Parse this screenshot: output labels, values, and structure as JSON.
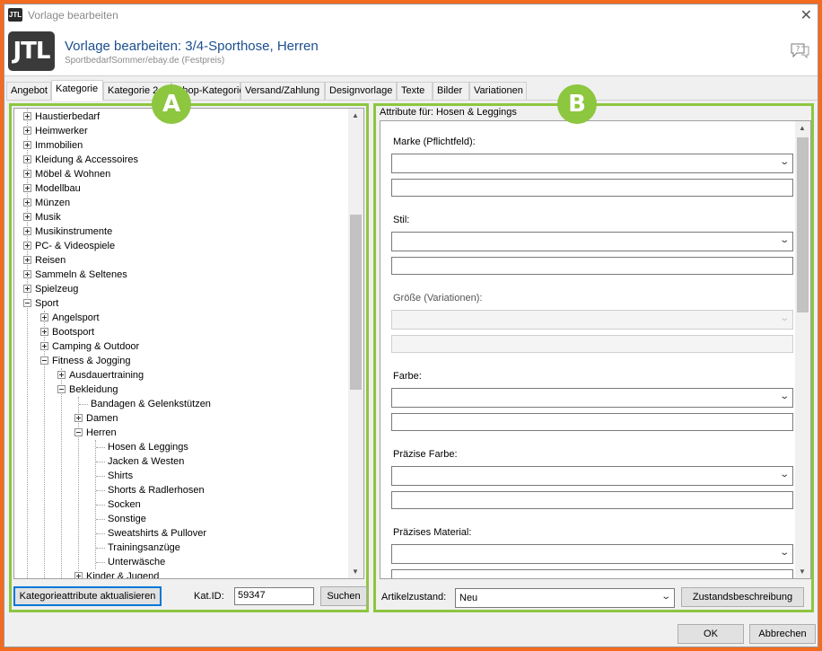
{
  "window": {
    "title": "Vorlage bearbeiten",
    "close": "✕"
  },
  "header": {
    "logo_text": "JTL",
    "title": "Vorlage bearbeiten: 3/4-Sporthose, Herren",
    "subtitle": "SportbedarfSommer/ebay.de (Festpreis)",
    "help_icon": "speech-bubble-help-icon"
  },
  "tabs": [
    "Angebot",
    "Kategorie",
    "Kategorie 2",
    "Shop-Kategorie",
    "Versand/Zahlung",
    "Designvorlage",
    "Texte",
    "Bilder",
    "Variationen"
  ],
  "badges": {
    "a": "A",
    "b": "B"
  },
  "tree": {
    "items": [
      {
        "label": "Haustierbedarf"
      },
      {
        "label": "Heimwerker"
      },
      {
        "label": "Immobilien"
      },
      {
        "label": "Kleidung & Accessoires"
      },
      {
        "label": "Möbel & Wohnen"
      },
      {
        "label": "Modellbau"
      },
      {
        "label": "Münzen"
      },
      {
        "label": "Musik"
      },
      {
        "label": "Musikinstrumente"
      },
      {
        "label": "PC- & Videospiele"
      },
      {
        "label": "Reisen"
      },
      {
        "label": "Sammeln & Seltenes"
      },
      {
        "label": "Spielzeug"
      },
      {
        "label": "Sport"
      },
      {
        "label": "Angelsport"
      },
      {
        "label": "Bootsport"
      },
      {
        "label": "Camping & Outdoor"
      },
      {
        "label": "Fitness & Jogging"
      },
      {
        "label": "Ausdauertraining"
      },
      {
        "label": "Bekleidung"
      },
      {
        "label": "Bandagen & Gelenkstützen"
      },
      {
        "label": "Damen"
      },
      {
        "label": "Herren"
      },
      {
        "label": "Hosen & Leggings"
      },
      {
        "label": "Jacken & Westen"
      },
      {
        "label": "Shirts"
      },
      {
        "label": "Shorts & Radlerhosen"
      },
      {
        "label": "Socken"
      },
      {
        "label": "Sonstige"
      },
      {
        "label": "Sweatshirts & Pullover"
      },
      {
        "label": "Trainingsanzüge"
      },
      {
        "label": "Unterwäsche"
      },
      {
        "label": "Kinder & Jugend"
      }
    ],
    "scroll_up": "▲",
    "scroll_down": "▼"
  },
  "left_footer": {
    "refresh_button": "Kategorieattribute aktualisieren",
    "katid_label": "Kat.ID:",
    "katid_value": "59347",
    "search_button": "Suchen"
  },
  "attributes": {
    "title": "Attribute für: Hosen & Leggings",
    "fields": [
      {
        "label": "Marke (Pflichtfeld):",
        "disabled": false
      },
      {
        "label": "Stil:",
        "disabled": false
      },
      {
        "label": "Größe (Variationen):",
        "disabled": true
      },
      {
        "label": "Farbe:",
        "disabled": false
      },
      {
        "label": "Präzise Farbe:",
        "disabled": false
      },
      {
        "label": "Präzises Material:",
        "disabled": false
      }
    ],
    "chevron": "⌄"
  },
  "right_footer": {
    "condition_label": "Artikelzustand:",
    "condition_value": "Neu",
    "condition_button": "Zustandsbeschreibung"
  },
  "dialog_buttons": {
    "ok": "OK",
    "cancel": "Abbrechen"
  },
  "colors": {
    "highlight_green": "#8dc63f",
    "frame_orange": "#f26b21",
    "title_blue": "#1c4f8f"
  }
}
